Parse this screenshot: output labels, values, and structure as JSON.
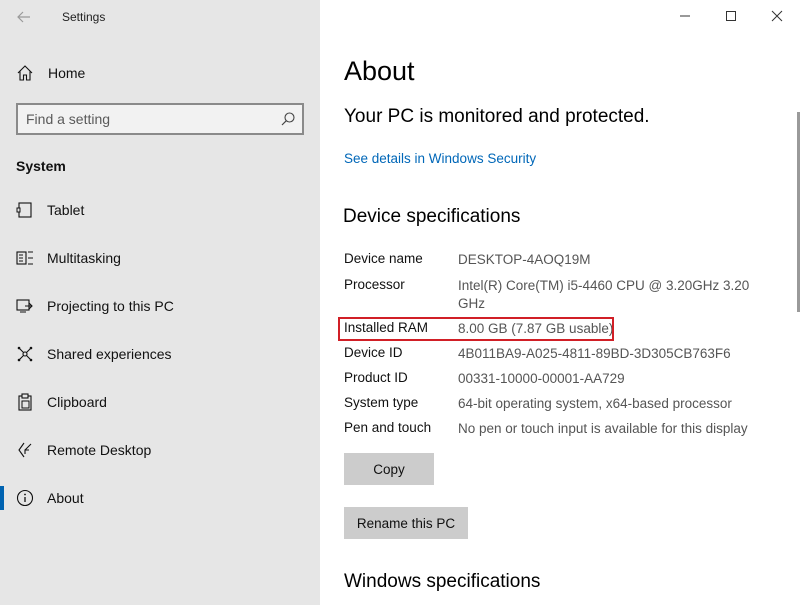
{
  "window": {
    "title": "Settings"
  },
  "sidebar": {
    "home_label": "Home",
    "search_placeholder": "Find a setting",
    "section_label": "System",
    "items": [
      {
        "label": "Tablet",
        "icon": "tablet-icon"
      },
      {
        "label": "Multitasking",
        "icon": "multitasking-icon"
      },
      {
        "label": "Projecting to this PC",
        "icon": "projecting-icon"
      },
      {
        "label": "Shared experiences",
        "icon": "shared-experiences-icon"
      },
      {
        "label": "Clipboard",
        "icon": "clipboard-icon"
      },
      {
        "label": "Remote Desktop",
        "icon": "remote-desktop-icon"
      },
      {
        "label": "About",
        "icon": "info-icon",
        "active": true
      }
    ]
  },
  "main": {
    "title": "About",
    "protection_status": "Your PC is monitored and protected.",
    "security_link": "See details in Windows Security",
    "device_specs_heading": "Device specifications",
    "specs": [
      {
        "key": "Device name",
        "value": "DESKTOP-4AOQ19M"
      },
      {
        "key": "Processor",
        "value": "Intel(R) Core(TM) i5-4460  CPU @ 3.20GHz   3.20 GHz"
      },
      {
        "key": "Installed RAM",
        "value": "8.00 GB (7.87 GB usable)",
        "highlighted": true
      },
      {
        "key": "Device ID",
        "value": "4B011BA9-A025-4811-89BD-3D305CB763F6"
      },
      {
        "key": "Product ID",
        "value": "00331-10000-00001-AA729"
      },
      {
        "key": "System type",
        "value": "64-bit operating system, x64-based processor"
      },
      {
        "key": "Pen and touch",
        "value": "No pen or touch input is available for this display"
      }
    ],
    "copy_button": "Copy",
    "rename_button": "Rename this PC",
    "windows_specs_heading": "Windows specifications"
  },
  "colors": {
    "accent": "#0063b1",
    "link": "#0067b8",
    "highlight_border": "#d11f26",
    "sidebar_bg": "#e6e6e6"
  }
}
